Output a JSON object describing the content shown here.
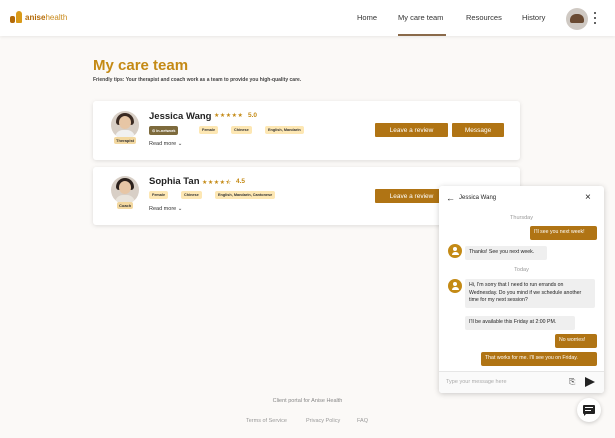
{
  "header": {
    "logo_bold": "anise",
    "logo_light": "health",
    "nav": [
      "Home",
      "My care team",
      "Resources",
      "History"
    ],
    "active_nav": "My care team"
  },
  "page": {
    "title": "My care team",
    "tips": "Friendly tips: Your therapist and coach work as a team to provide you high-quality care."
  },
  "care_team": [
    {
      "name": "Jessica Wang",
      "role": "Therapist",
      "stars": "★★★★★",
      "rating": "5.0",
      "chips": [
        "In-network",
        "Female",
        "Chinese",
        "English, Mandarin"
      ],
      "read_more": "Read more",
      "review_label": "Leave a review",
      "message_label": "Message"
    },
    {
      "name": "Sophia Tan",
      "role": "Coach",
      "stars": "★★★★⯪",
      "rating": "4.5",
      "chips": [
        "Female",
        "Chinese",
        "English, Mandarin, Cantonese"
      ],
      "read_more": "Read more",
      "review_label": "Leave a review"
    }
  ],
  "chat": {
    "contact": "Jessica Wang",
    "days": [
      "Thursday",
      "Today"
    ],
    "messages": [
      {
        "from": "me",
        "text": "I'll see you next week!"
      },
      {
        "from": "them",
        "text": "Thanks! See you next week."
      },
      {
        "from": "them",
        "text": "Hi, I'm sorry that I need to run errands on Wednesday. Do you mind if we schedule another time for my next session?"
      },
      {
        "from": "them",
        "text": "I'll be available this Friday at 2:00 PM."
      },
      {
        "from": "me",
        "text": "No worries!"
      },
      {
        "from": "me",
        "text": "That works for me. I'll see you on Friday."
      }
    ],
    "placeholder": "Type your message here"
  },
  "footer": {
    "portal": "Client portal for Anise Health",
    "links": [
      "Terms of Service",
      "Privacy Policy",
      "FAQ"
    ]
  },
  "colors": {
    "accent": "#b07414",
    "title": "#c48a15",
    "chip": "#fde7b3"
  },
  "icons": [
    "logo-icon",
    "chevron-down-icon",
    "arrow-left-icon",
    "close-icon",
    "user-icon",
    "paperclip-icon",
    "send-icon",
    "chat-icon",
    "kebab-icon"
  ]
}
